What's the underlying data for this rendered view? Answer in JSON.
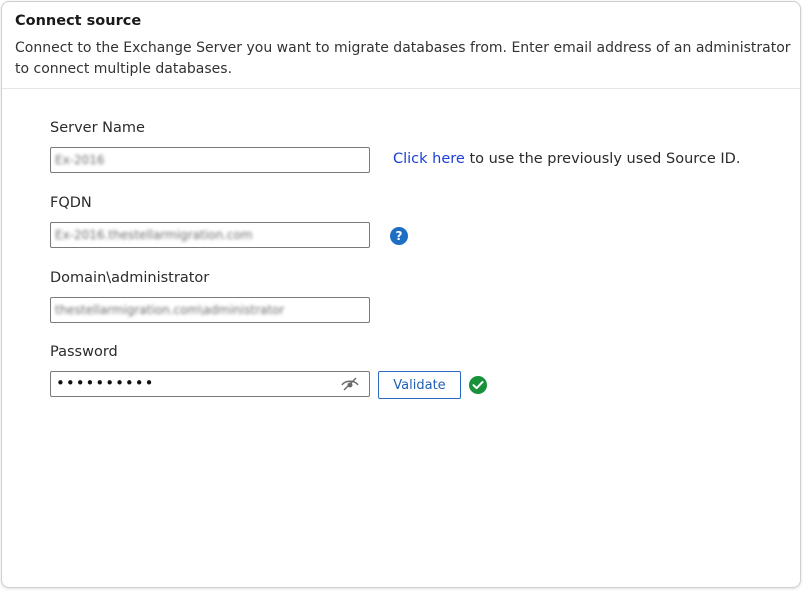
{
  "header": {
    "title": "Connect source",
    "description": "Connect to the Exchange Server you want to migrate databases from. Enter email address of an administrator to connect multiple databases."
  },
  "form": {
    "server_name_label": "Server Name",
    "server_name_value": "Ex-2016",
    "link_text": "Click here",
    "link_suffix": " to use the previously used Source ID.",
    "fqdn_label": "FQDN",
    "fqdn_value": "Ex-2016.thestellarmigration.com",
    "help_icon": "question-circle-icon",
    "domain_label": "Domain\\administrator",
    "domain_value": "thestellarmigration.com\\administrator",
    "password_label": "Password",
    "password_mask": "••••••••••",
    "eye_icon": "eye-off-icon",
    "validate_label": "Validate",
    "status_icon": "check-circle-icon"
  },
  "colors": {
    "link": "#1a3fd6",
    "help_icon_bg": "#1e6fc4",
    "validate_border": "#2a6ac2",
    "success": "#17913a"
  }
}
